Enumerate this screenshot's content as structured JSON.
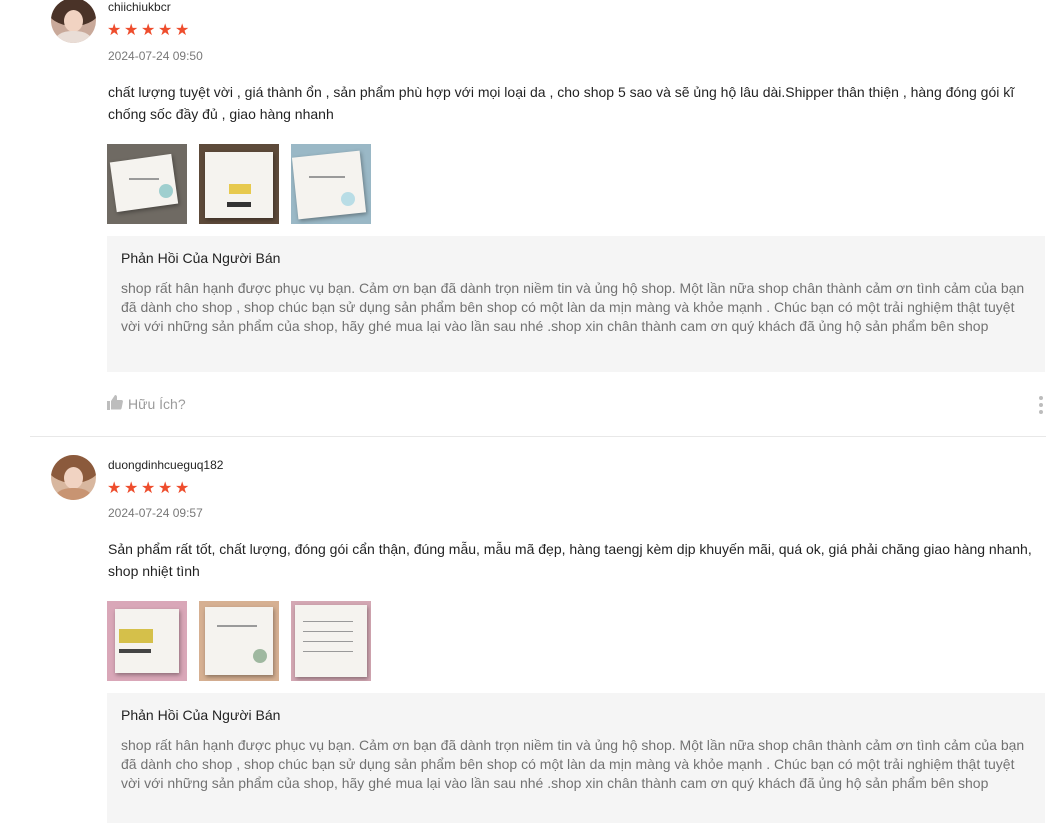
{
  "reviews": [
    {
      "username": "chiichiukbcr",
      "rating": 5,
      "date": "2024-07-24 09:50",
      "comment": "chất lượng tuyệt vời , giá thành ổn , sản phẩm phù hợp với mọi loại da , cho shop 5 sao và sẽ ủng hộ lâu dài.Shipper thân thiện , hàng đóng gói kĩ chống sốc đầy đủ , giao hàng nhanh",
      "reply_title": "Phản Hồi Của Người Bán",
      "reply_text": "shop rất hân hạnh được phục vụ bạn. Cảm ơn bạn đã dành trọn niềm tin và ủng hộ shop. Một lần nữa shop chân thành cảm ơn tình cảm của bạn đã dành cho shop , shop chúc bạn sử dụng sản phẩm bên shop có một làn da mịn màng và khỏe mạnh . Chúc bạn có một trải nghiệm thật tuyệt vời với những sản phẩm của shop, hãy ghé mua lại vào lần sau nhé .shop xin chân thành cam ơn quý khách đã ủng hộ sản phẩm bên shop",
      "helpful_label": "Hữu Ích?"
    },
    {
      "username": "duongdinhcueguq182",
      "rating": 5,
      "date": "2024-07-24 09:57",
      "comment": "Sản phẩm rất tốt, chất lượng, đóng gói cẩn thận, đúng mẫu, mẫu mã đẹp, hàng taengj kèm dịp khuyến mãi, quá ok, giá phải chăng giao hàng nhanh, shop nhiệt tình",
      "reply_title": "Phản Hồi Của Người Bán",
      "reply_text": "shop rất hân hạnh được phục vụ bạn. Cảm ơn bạn đã dành trọn niềm tin và ủng hộ shop. Một lần nữa shop chân thành cảm ơn tình cảm của bạn đã dành cho shop , shop chúc bạn sử dụng sản phẩm bên shop có một làn da mịn màng và khỏe mạnh . Chúc bạn có một trải nghiệm thật tuyệt vời với những sản phẩm của shop, hãy ghé mua lại vào lần sau nhé .shop xin chân thành cam ơn quý khách đã ủng hộ sản phẩm bên shop"
    }
  ],
  "icons": {
    "star": "star-icon",
    "thumb": "thumbs-up-icon",
    "more": "more-vertical-icon"
  },
  "colors": {
    "star": "#ee4d2d",
    "reply_bg": "#f5f5f5"
  }
}
